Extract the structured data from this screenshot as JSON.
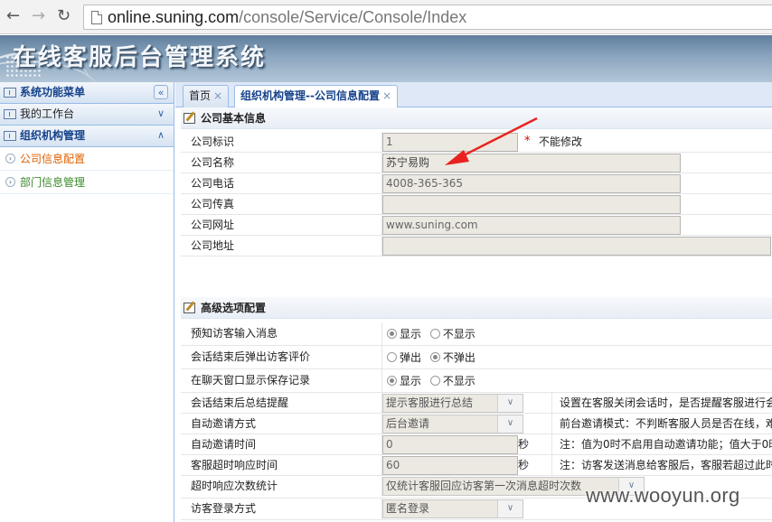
{
  "browser": {
    "url_host": "online.suning.com",
    "url_path": "/console/Service/Console/Index"
  },
  "banner": {
    "title": "在线客服后台管理系统"
  },
  "sidebar": {
    "header": "系统功能菜单",
    "panels": [
      {
        "label": "我的工作台"
      },
      {
        "label": "组织机构管理"
      }
    ],
    "items": [
      {
        "label": "公司信息配置"
      },
      {
        "label": "部门信息管理"
      }
    ]
  },
  "tabs": [
    {
      "label": "首页",
      "close": "×"
    },
    {
      "label": "组织机构管理--公司信息配置",
      "close": "×"
    }
  ],
  "basic": {
    "title": "公司基本信息",
    "fields": [
      {
        "label": "公司标识",
        "value": ""
      },
      {
        "label": "公司名称",
        "value": "苏宁易购"
      },
      {
        "label": "公司电话",
        "value": "4008-365-365"
      },
      {
        "label": "公司传真",
        "value": ""
      },
      {
        "label": "公司网址",
        "value": "www.suning.com"
      },
      {
        "label": "公司地址",
        "value": ""
      }
    ],
    "company_id": "1",
    "required_mark": "*",
    "readonly_note": "不能修改"
  },
  "advanced": {
    "title": "高级选项配置",
    "radio_rows": [
      {
        "label": "预知访客输入消息",
        "options": [
          "显示",
          "不显示"
        ],
        "selected": 0
      },
      {
        "label": "会话结束后弹出访客评价",
        "options": [
          "弹出",
          "不弹出"
        ],
        "selected": 1
      },
      {
        "label": "在聊天窗口显示保存记录",
        "options": [
          "显示",
          "不显示"
        ],
        "selected": 0
      }
    ],
    "rows": [
      {
        "label": "会话结束后总结提醒",
        "value": "提示客服进行总结",
        "desc": "设置在客服关闭会话时，是否提醒客服进行会"
      },
      {
        "label": "自动邀请方式",
        "value": "后台邀请",
        "desc": "前台邀请模式：不判断客服人员是否在线，难"
      },
      {
        "label": "自动邀请时间",
        "value": "0",
        "unit": "秒",
        "desc": "注：值为0时不启用自动邀请功能；值大于0时"
      },
      {
        "label": "客服超时响应时间",
        "value": "60",
        "unit": "秒",
        "desc": "注：访客发送消息给客服后，客服若超过此时"
      },
      {
        "label": "超时响应次数统计",
        "value": "仅统计客服回应访客第一次消息超时次数"
      },
      {
        "label": "访客登录方式",
        "value": "匿名登录"
      }
    ]
  },
  "watermark": "www.wooyun.org",
  "icons": {
    "collapse": "«",
    "expand": "∨",
    "collapse_up": "∧",
    "dropdown": "∨"
  }
}
